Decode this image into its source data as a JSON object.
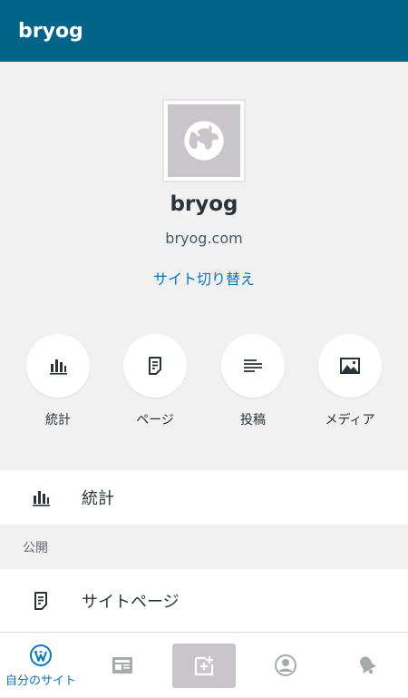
{
  "app_bar": {
    "title": "bryog"
  },
  "site": {
    "name": "bryog",
    "url": "bryog.com",
    "switch_site_label": "サイト切り替え",
    "icon": "globe-icon"
  },
  "quick_actions": [
    {
      "label": "統計",
      "icon": "stats-icon"
    },
    {
      "label": "ページ",
      "icon": "page-icon"
    },
    {
      "label": "投稿",
      "icon": "posts-icon"
    },
    {
      "label": "メディア",
      "icon": "media-icon"
    }
  ],
  "menu": {
    "stats_label": "統計",
    "section_publish": "公開",
    "site_pages_label": "サイトページ"
  },
  "bottom_nav": {
    "my_site_label": "自分のサイト",
    "tabs": [
      "wordpress-icon",
      "reader-icon",
      "new-post-icon",
      "profile-icon",
      "notifications-icon"
    ]
  },
  "colors": {
    "app_bar": "#03648a",
    "accent": "#0675c4",
    "background": "#f2f1f2",
    "icon": "#2c3338"
  }
}
